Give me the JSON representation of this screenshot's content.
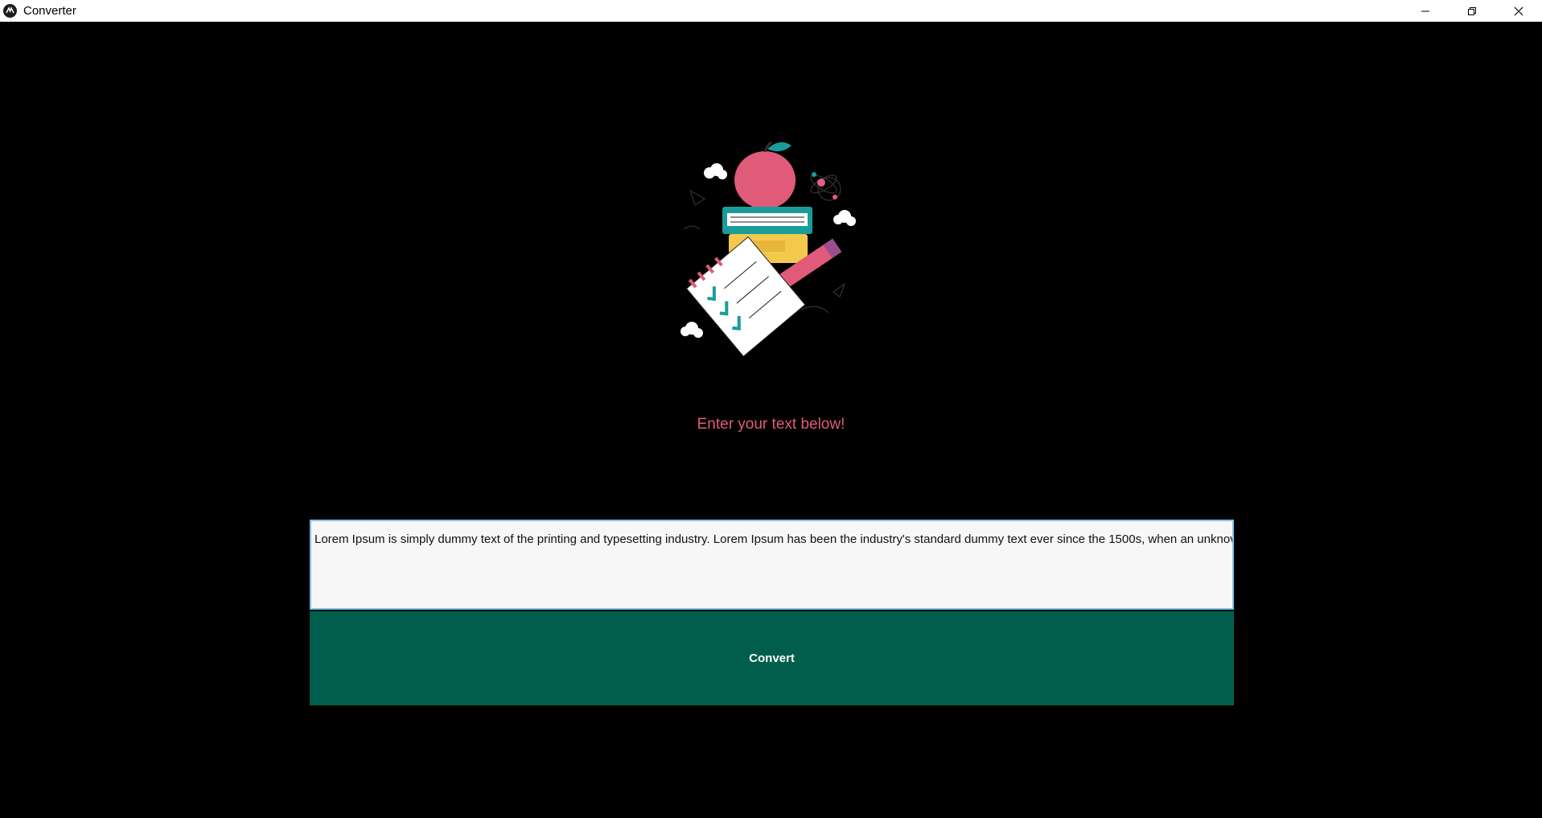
{
  "window": {
    "title": "Converter",
    "app_icon": "kivy-logo-icon",
    "controls": [
      "minimize-icon",
      "restore-icon",
      "close-icon"
    ]
  },
  "main": {
    "illustration": "apple-books-notepad-pencil-illustration",
    "prompt": "Enter your text below!",
    "input_value": "Lorem Ipsum is simply dummy text of the printing and typesetting industry. Lorem Ipsum has been the industry's standard dummy text ever since the 1500s, when an unknov",
    "convert_label": "Convert"
  },
  "colors": {
    "background": "#000000",
    "prompt": "#e05a79",
    "button": "#025e4c",
    "input_bg": "#f7f7f7",
    "input_border": "#7fc4e8"
  }
}
